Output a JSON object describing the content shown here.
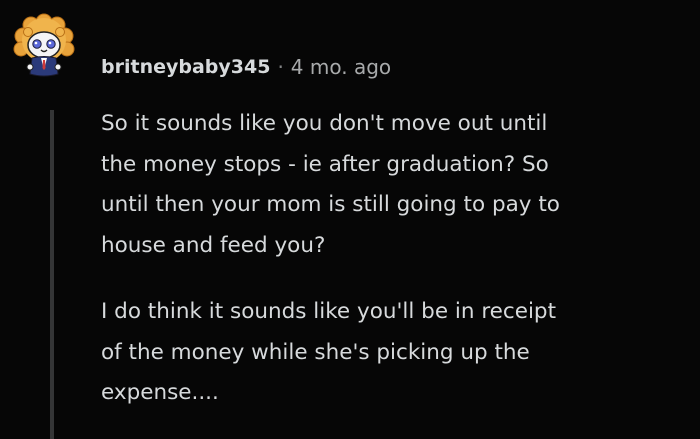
{
  "comment": {
    "author": "britneybaby345",
    "separator": "·",
    "timestamp": "4 mo. ago",
    "avatar_icon": "snoo-lion-avatar-icon",
    "paragraphs": [
      "So it sounds like you don't move out until\nthe money stops - ie after graduation? So\nuntil then your mom is still going to pay to\nhouse and feed you?",
      "I do think it sounds like you'll be in receipt\nof the money while she's picking up the\nexpense...."
    ]
  },
  "colors": {
    "background": "#060606",
    "text": "#d7dadc",
    "meta": "#a8aaab",
    "thread_line": "#343536"
  }
}
